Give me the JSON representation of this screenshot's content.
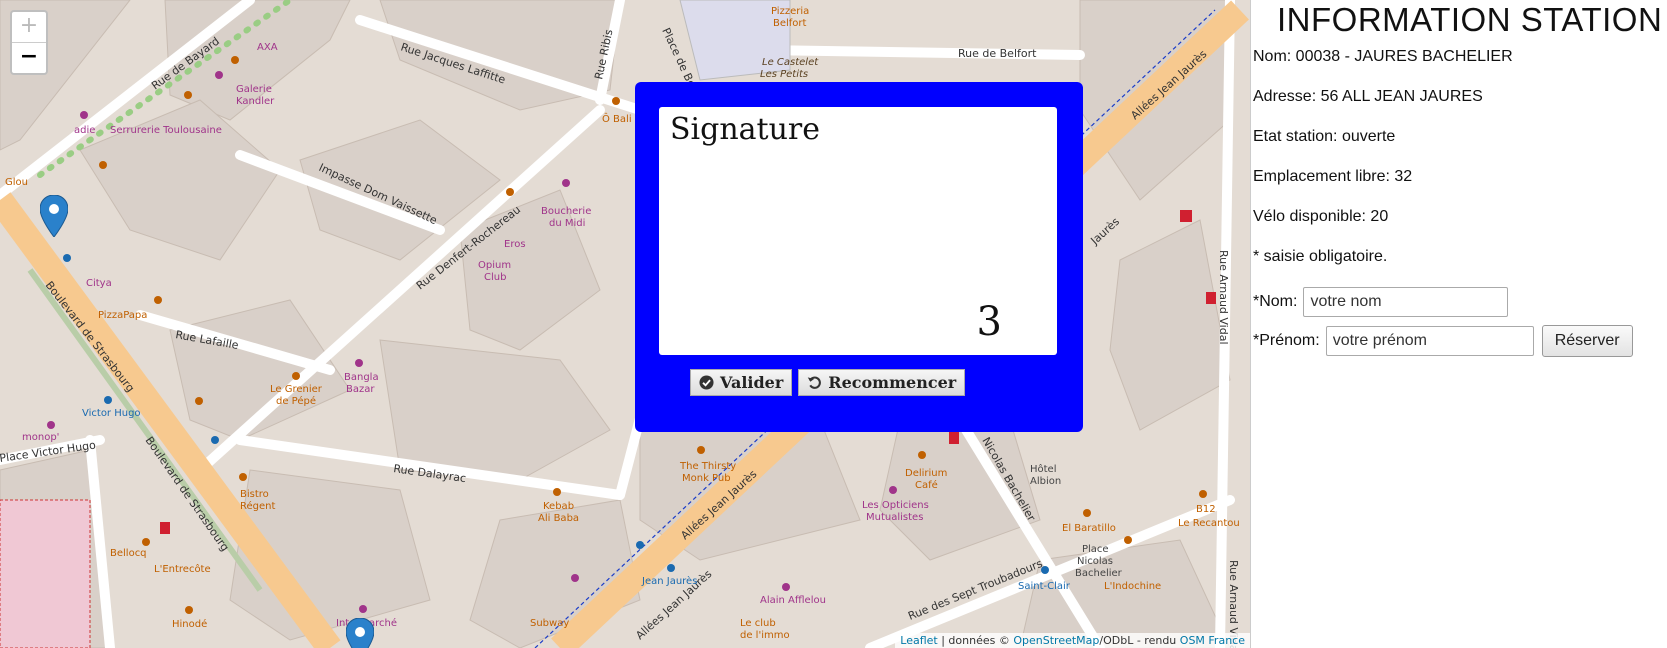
{
  "map": {
    "zoom_in": "+",
    "zoom_out": "−",
    "streets": [
      "Rue de Bayard",
      "Rue Jacques Laffitte",
      "Rue de Belfort",
      "Rue Ribis",
      "Place de Belfort",
      "Impasse Dom Vaissette",
      "Rue Denfert-Rochereau",
      "Rue Lafaille",
      "Boulevard de Strasbourg",
      "Boulevard de Strasbourg",
      "Rue Dalayrac",
      "Allées Jean Jaurès",
      "Allées Jean Jaurès",
      "Allées Jean Jaurès",
      "Nicolas Bachelier",
      "Rue des Sept Troubadours",
      "Rue Arnaud Vidal",
      "Rue Arnaud Vidal",
      "Place Victor Hugo",
      "Jaurès"
    ],
    "pois": [
      "Galerie Kandler",
      "Serrurerie Toulousaine",
      "AXA",
      "Pizzeria Belfort",
      "Le Castelet Les Petits Galopins",
      "Ô Bali",
      "Boucherie du Midi",
      "Eros",
      "Opium Club",
      "Cityа",
      "PizzaPapa",
      "Victor Hugo",
      "monop'",
      "Bangla Bazar",
      "Le Grenier de Pépé",
      "Bistro Régent",
      "Kebab Ali Baba",
      "The Thirsty Monk Pub",
      "Delirium Café",
      "Hôtel Albion",
      "Les Opticiens Mutualistes",
      "El Baratillo",
      "Le Recantou",
      "Place Nicolas Bachelier",
      "L'Indochine",
      "Saint-Clair",
      "Jean Jaurès",
      "Alain Afflelou",
      "Le club de l'immo",
      "Subway",
      "Intermarché",
      "Bellocq",
      "L'Entrecôte",
      "Hinodé",
      "Glou",
      "adie",
      "B12"
    ],
    "attribution": {
      "leaflet": "Leaflet",
      "donnees": "| données ©",
      "osm": "OpenStreetMap",
      "odbl": "/ODbL - rendu",
      "osmfr": "OSM France"
    },
    "colors": {
      "background": "#e4dcd4",
      "major_road": "#f7c98f",
      "marker": "#2a81cb"
    }
  },
  "signature_modal": {
    "title": "Signature",
    "countdown": "3",
    "validate_label": "Valider",
    "restart_label": "Recommencer",
    "colors": {
      "frame": "#0000ff"
    }
  },
  "panel": {
    "title": "INFORMATION STATION",
    "nom": "Nom: 00038 - JAURES BACHELIER",
    "adresse": "Adresse: 56 ALL JEAN JAURES",
    "etat": "Etat station: ouverte",
    "emplacement": "Emplacement libre: 32",
    "velo": "Vélo disponible: 20",
    "required_note": "* saisie obligatoire.",
    "form": {
      "nom_label": "*Nom:",
      "nom_placeholder": "votre nom",
      "prenom_label": "*Prénom:",
      "prenom_placeholder": "votre prénom",
      "reserve_label": "Réserver"
    }
  }
}
